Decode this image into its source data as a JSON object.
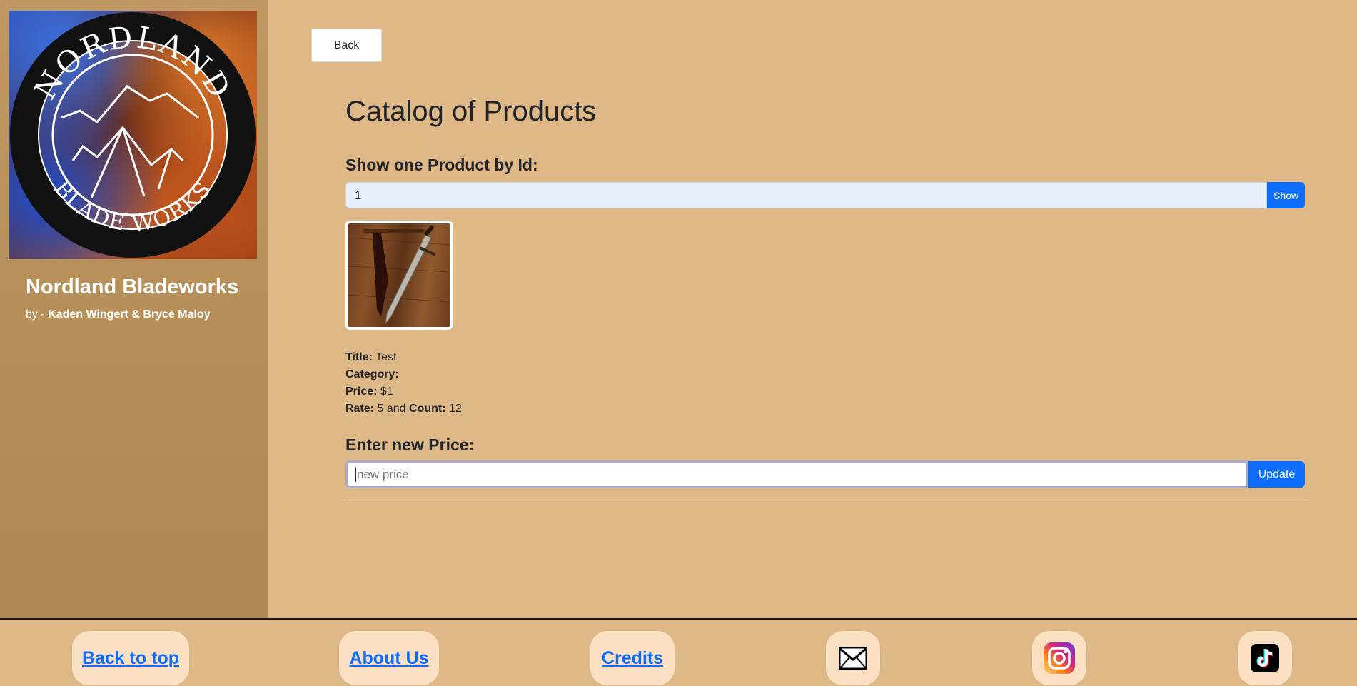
{
  "sidebar": {
    "logo": {
      "top_text": "NORDLAND",
      "bottom_text": "BLADE WORKS"
    },
    "title": "Nordland Bladeworks",
    "byline_prefix": "by - ",
    "authors": "Kaden Wingert & Bryce Maloy"
  },
  "main": {
    "back_label": "Back",
    "page_title": "Catalog of Products",
    "show_heading": "Show one Product by Id:",
    "id_value": "1",
    "show_label": "Show",
    "product_image": "knife-image",
    "product": {
      "title_label": "Title:",
      "title_value": "Test",
      "category_label": "Category:",
      "category_value": "",
      "price_label": "Price:",
      "price_value": "$1",
      "rate_label": "Rate:",
      "rate_value": "5",
      "and_text": "and",
      "count_label": "Count:",
      "count_value": "12"
    },
    "price_heading": "Enter new Price:",
    "price_placeholder": "new price",
    "update_label": "Update"
  },
  "footer": {
    "back_to_top": "Back to top",
    "about_us": "About Us",
    "credits": "Credits",
    "icons": [
      "mail-icon",
      "instagram-icon",
      "tiktok-icon"
    ]
  },
  "colors": {
    "page_bg": "#deb887",
    "accent_blue": "#0d6efd",
    "pill_bg": "#fbe0c3"
  }
}
